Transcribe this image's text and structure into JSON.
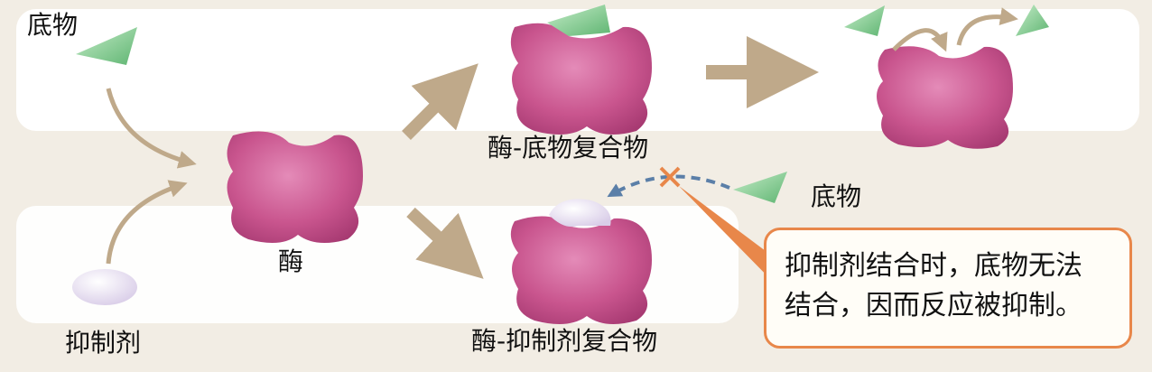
{
  "labels": {
    "substrate_top": "底物",
    "inhibitor": "抑制剂",
    "enzyme": "酶",
    "es_complex": "酶-底物复合物",
    "ei_complex": "酶-抑制剂复合物",
    "substrate_right": "底物"
  },
  "callout": {
    "line1": "抑制剂结合时，底物无法",
    "line2": "结合，因而反应被抑制。"
  },
  "colors": {
    "background": "#f2ede4",
    "panel": "#ffffff",
    "enzyme": "#c9558e",
    "substrate": "#7fc98b",
    "inhibitor": "#e7def0",
    "arrow": "#bfa98a",
    "blocked_arrow": "#5b7fa8",
    "cross": "#e8874a",
    "callout_border": "#e8874a"
  }
}
